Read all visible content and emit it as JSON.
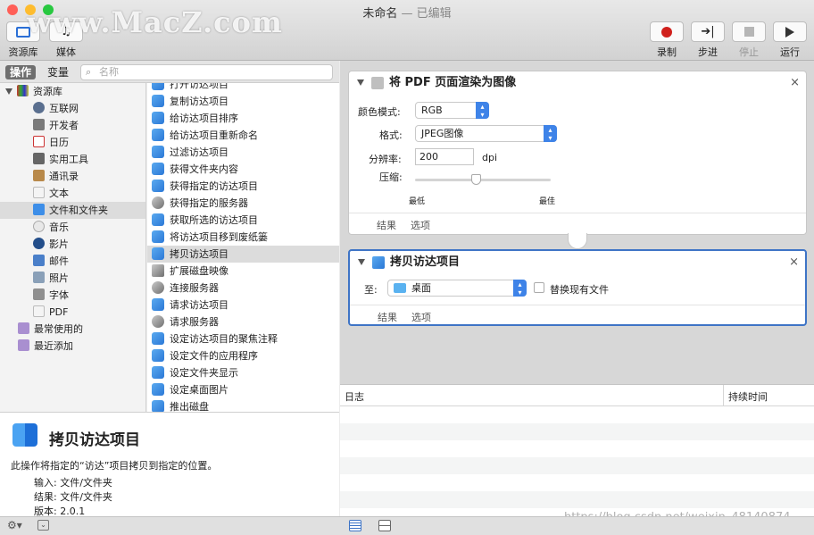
{
  "window": {
    "title": "未命名",
    "subtitle": "— 已编辑"
  },
  "watermark": "www.MacZ.com",
  "toolbar": {
    "library": "资源库",
    "media": "媒体",
    "record": "录制",
    "step": "步进",
    "stop": "停止",
    "run": "运行"
  },
  "left": {
    "tabs": {
      "actions": "操作",
      "variables": "变量"
    },
    "search_placeholder": "名称"
  },
  "library": {
    "root": "资源库",
    "items": [
      "互联网",
      "开发者",
      "日历",
      "实用工具",
      "通讯录",
      "文本",
      "文件和文件夹",
      "音乐",
      "影片",
      "邮件",
      "照片",
      "字体",
      "PDF"
    ],
    "smart": [
      "最常使用的",
      "最近添加"
    ]
  },
  "actions": [
    "打开访达项目",
    "复制访达项目",
    "给访达项目排序",
    "给访达项目重新命名",
    "过滤访达项目",
    "获得文件夹内容",
    "获得指定的访达项目",
    "获得指定的服务器",
    "获取所选的访达项目",
    "将访达项目移到废纸篓",
    "拷贝访达项目",
    "扩展磁盘映像",
    "连接服务器",
    "请求访达项目",
    "请求服务器",
    "设定访达项目的聚焦注释",
    "设定文件的应用程序",
    "设定文件夹显示",
    "设定桌面图片",
    "推出磁盘"
  ],
  "description": {
    "title": "拷贝访达项目",
    "text": "此操作将指定的“访达”项目拷贝到指定的位置。",
    "input_label": "输入:",
    "input": "文件/文件夹",
    "result_label": "结果:",
    "result": "文件/文件夹",
    "version_label": "版本:",
    "version": "2.0.1"
  },
  "card1": {
    "title": "将 PDF 页面渲染为图像",
    "color_mode_label": "颜色模式:",
    "color_mode": "RGB",
    "format_label": "格式:",
    "format": "JPEG图像",
    "resolution_label": "分辨率:",
    "resolution": "200",
    "resolution_unit": "dpi",
    "compression_label": "压缩:",
    "compression_level": 0.45,
    "min": "最低",
    "max": "最佳",
    "results": "结果",
    "options": "选项"
  },
  "card2": {
    "title": "拷贝访达项目",
    "to_label": "至:",
    "to": "桌面",
    "replace": "替换现有文件",
    "results": "结果",
    "options": "选项"
  },
  "log": {
    "col_log": "日志",
    "col_duration": "持续时间"
  },
  "url_watermark": "https://blog.csdn.net/weixin_48140874",
  "colors": {
    "accent": "#3e83e8",
    "record": "#d0201c",
    "selection": "#3e74c6"
  }
}
